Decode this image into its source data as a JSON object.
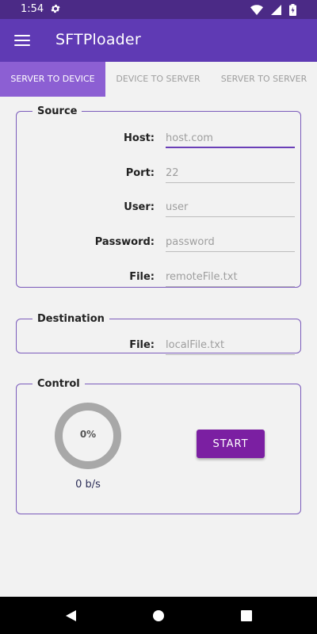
{
  "status": {
    "time": "1:54"
  },
  "app": {
    "title": "SFTPloader"
  },
  "tabs": [
    {
      "label": "SERVER TO DEVICE",
      "active": true
    },
    {
      "label": "DEVICE TO SERVER",
      "active": false
    },
    {
      "label": "SERVER TO SERVER",
      "active": false
    }
  ],
  "source": {
    "legend": "Source",
    "fields": [
      {
        "label": "Host:",
        "placeholder": "host.com",
        "value": ""
      },
      {
        "label": "Port:",
        "placeholder": "22",
        "value": ""
      },
      {
        "label": "User:",
        "placeholder": "user",
        "value": ""
      },
      {
        "label": "Password:",
        "placeholder": "password",
        "value": ""
      },
      {
        "label": "File:",
        "placeholder": "remoteFile.txt",
        "value": ""
      }
    ]
  },
  "destination": {
    "legend": "Destination",
    "fields": [
      {
        "label": "File:",
        "placeholder": "localFile.txt",
        "value": ""
      }
    ]
  },
  "control": {
    "legend": "Control",
    "progress_text": "0%",
    "progress": 0,
    "rate_text": "0 b/s",
    "start_label": "START"
  },
  "colors": {
    "status_bar": "#4b2a86",
    "app_bar": "#5f3ab4",
    "active_tab": "#8c5fd3",
    "accent": "#7b1fa2",
    "border": "#7b5bbb"
  },
  "icons": {
    "menu": "menu-icon",
    "settings": "gear-icon",
    "wifi": "wifi-icon",
    "signal": "signal-icon",
    "battery": "battery-icon",
    "back": "back-icon",
    "home": "home-icon",
    "recents": "recents-icon"
  }
}
